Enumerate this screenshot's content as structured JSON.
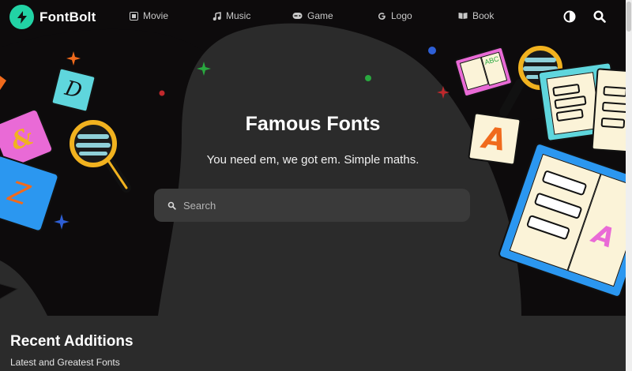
{
  "brand": {
    "name": "FontBolt"
  },
  "nav": {
    "items": [
      {
        "label": "Movie",
        "icon": "film-icon"
      },
      {
        "label": "Music",
        "icon": "music-note-icon"
      },
      {
        "label": "Game",
        "icon": "gamepad-icon"
      },
      {
        "label": "Logo",
        "icon": "google-g-icon"
      },
      {
        "label": "Book",
        "icon": "open-book-icon"
      }
    ],
    "actions": [
      {
        "icon": "theme-toggle-icon"
      },
      {
        "icon": "search-icon"
      }
    ]
  },
  "hero": {
    "title": "Famous Fonts",
    "subtitle": "You need em, we got em. Simple maths.",
    "search_placeholder": "Search",
    "search_value": ""
  },
  "section": {
    "title": "Recent Additions",
    "subtitle": "Latest and Greatest Fonts"
  },
  "decorations": {
    "card_glyphs": [
      "D",
      "A",
      "A",
      "Z",
      "&"
    ],
    "book_badge": "ABC"
  },
  "colors": {
    "background": "#2b2b2b",
    "blob": "#0d0b0c",
    "accent": "#22d3a5",
    "card_blue": "#2b97f0",
    "card_teal": "#5fd6dd",
    "card_pink": "#e96ad6",
    "glyph_orange": "#f06a1c",
    "lens_gold": "#f1b21f"
  }
}
